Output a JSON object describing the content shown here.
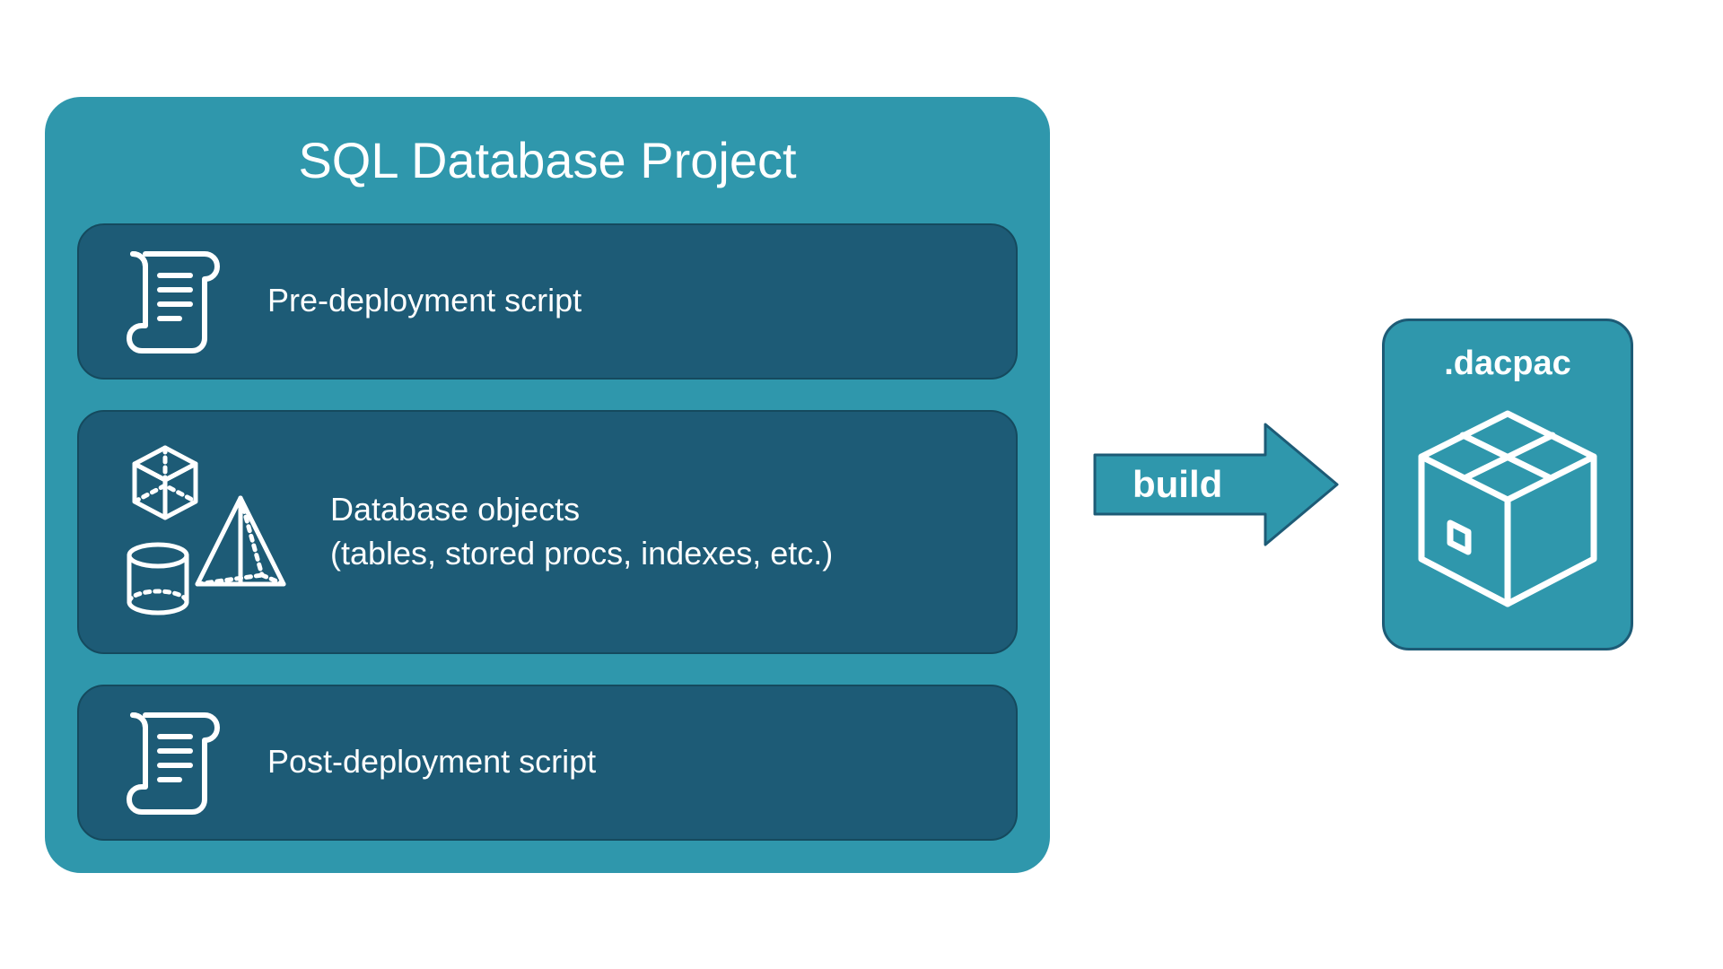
{
  "project": {
    "title": "SQL Database Project",
    "pre_script_label": "Pre-deployment script",
    "objects_label_line1": "Database objects",
    "objects_label_line2": "(tables, stored procs, indexes, etc.)",
    "post_script_label": "Post-deployment script"
  },
  "arrow": {
    "label": "build"
  },
  "output": {
    "label": ".dacpac"
  },
  "colors": {
    "container_bg": "#2f97ac",
    "card_bg": "#1d5b76",
    "text": "#ffffff"
  }
}
